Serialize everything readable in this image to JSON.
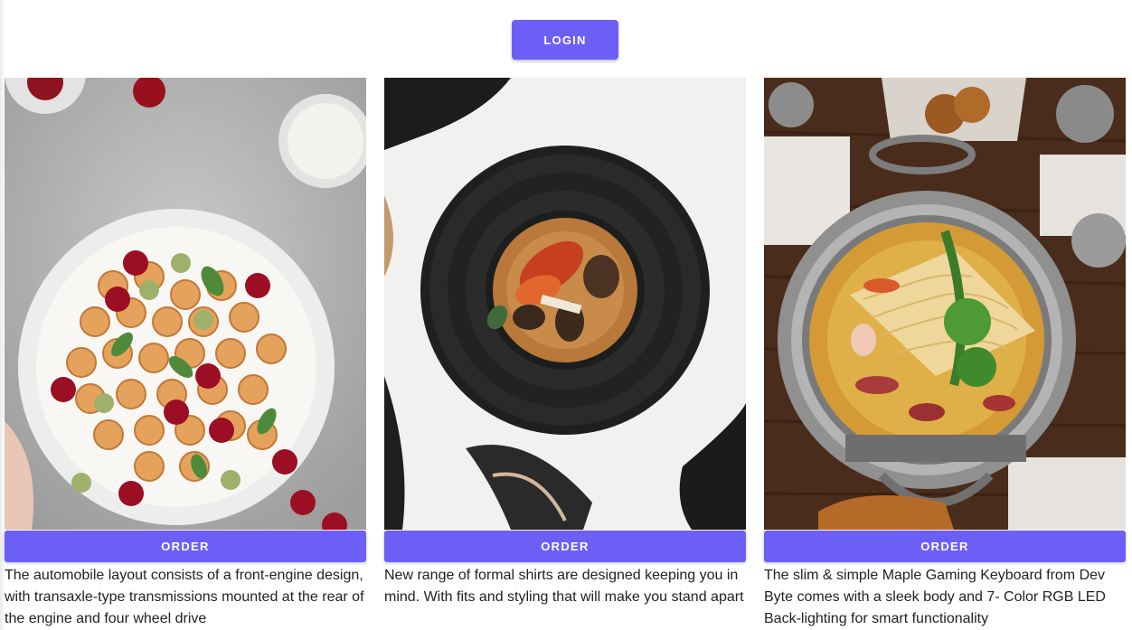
{
  "header": {
    "login_label": "LOGIN"
  },
  "cards": [
    {
      "image": "pancakes-cherries-photo",
      "order_label": "ORDER",
      "description": "The automobile layout consists of a front-engine design, with transaxle-type transmissions mounted at the rear of the engine and four wheel drive"
    },
    {
      "image": "lobster-plate-photo",
      "order_label": "ORDER",
      "description": "New range of formal shirts are designed keeping you in mind. With fits and styling that will make you stand apart"
    },
    {
      "image": "ramen-hotpot-photo",
      "order_label": "ORDER",
      "description": "The slim & simple Maple Gaming Keyboard from Dev Byte comes with a sleek body and 7- Color RGB LED Back-lighting for smart functionality"
    }
  ],
  "colors": {
    "accent": "#6c5ff6",
    "text": "#222222"
  }
}
